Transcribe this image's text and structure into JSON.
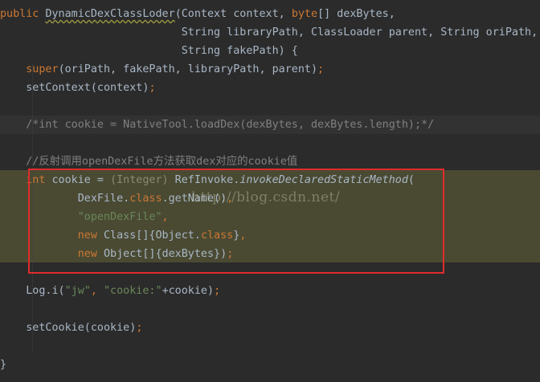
{
  "editor": {
    "lines": {
      "l1": {
        "kw1": "public",
        "t1": " ",
        "cls": "DynamicDexClassLoder",
        "t2": "(Context context, ",
        "kw2": "byte",
        "t3": "[] dexBytes,"
      },
      "l2": {
        "t1": "                            String libraryPath, ClassLoader parent, String oriPath,"
      },
      "l3": {
        "t1": "                            String fakePath) {"
      },
      "l4": {
        "kw1": "    super",
        "t1": "(oriPath, fakePath, libraryPath, parent)",
        "p1": ";"
      },
      "l5": {
        "t1": "    setContext(context)",
        "p1": ";"
      },
      "l6": {
        "c1": "    /*int cookie = NativeTool.loadDex(dexBytes, dexBytes.length);*/"
      },
      "l7": {
        "c1": "    //反射调用openDexFile方法获取dex对应的cookie值"
      },
      "l8": {
        "kw1": "    int",
        "t1": " cookie = ",
        "d1": "(Integer)",
        "t2": " RefInvoke.",
        "it1": "invokeDeclaredStaticMethod",
        "t3": "("
      },
      "l9": {
        "t1": "            DexFile.",
        "kw1": "class",
        "t2": ".getName()",
        "p1": ","
      },
      "l10": {
        "s1": "            \"openDexFile\"",
        "p1": ","
      },
      "l11": {
        "kw1": "            new",
        "t1": " Class[]{Object.",
        "kw2": "class",
        "t2": "}",
        "p1": ","
      },
      "l12": {
        "kw1": "            new",
        "t1": " Object[]{dexBytes})",
        "p1": ";"
      },
      "l13": {
        "t1": "    Log.i(",
        "s1": "\"jw\"",
        "p1": ", ",
        "s2": "\"cookie:\"",
        "t2": "+cookie)",
        "p2": ";"
      },
      "l14": {
        "t1": "    setCookie(cookie)",
        "p1": ";"
      },
      "l15": {
        "t1": "}"
      }
    },
    "watermark": "http://blog.csdn.net/"
  },
  "colors": {
    "background": "#2b2b2b",
    "keyword": "#cc7832",
    "string": "#6a8759",
    "comment": "#808080",
    "text": "#a9b7c6",
    "highlight_band": "#4a4a33",
    "annotation_box": "#e02b2b"
  }
}
